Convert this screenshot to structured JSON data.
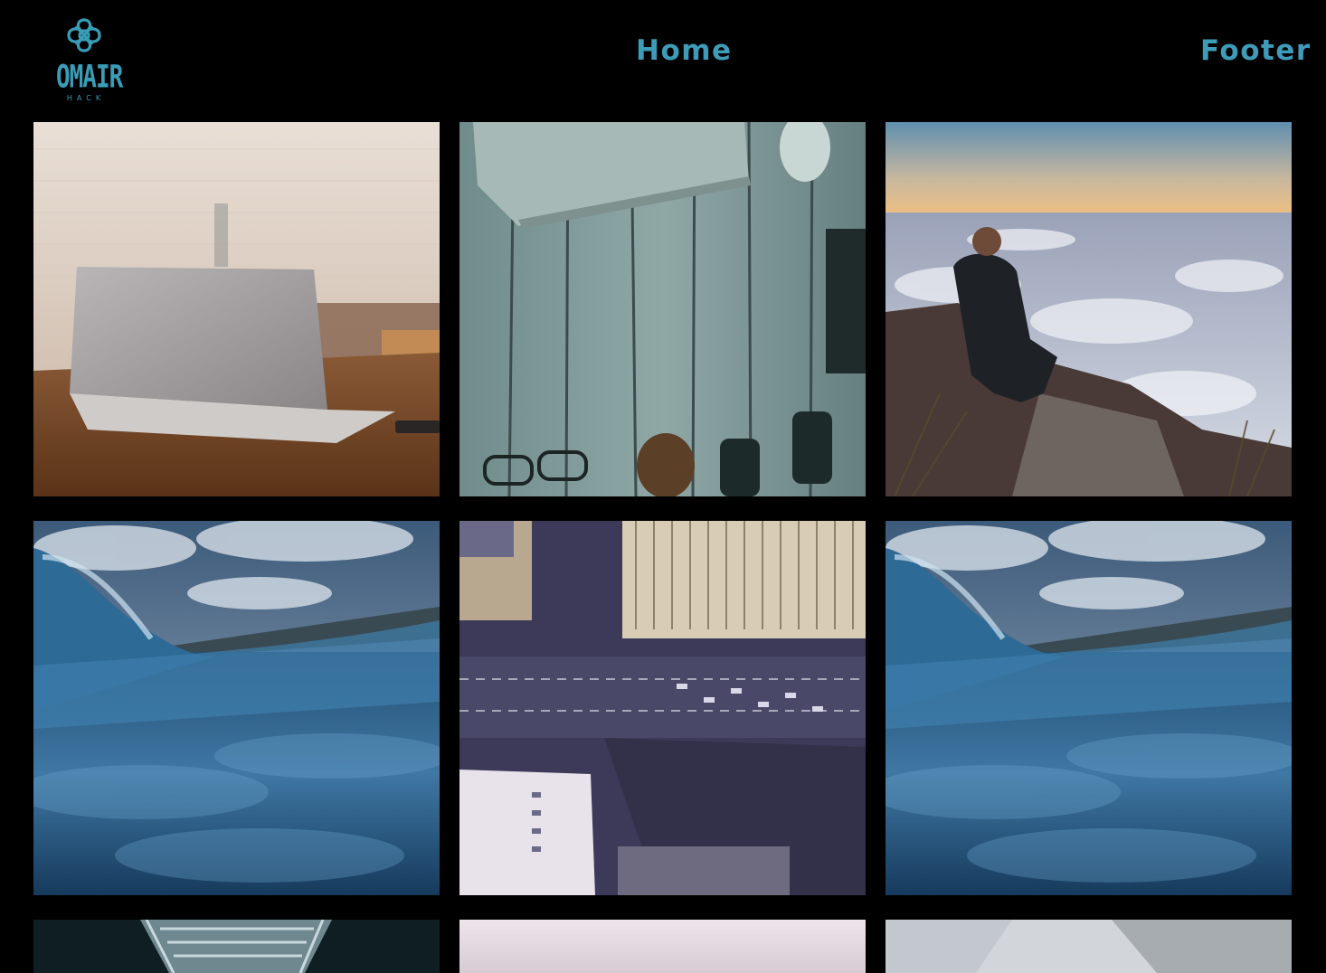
{
  "header": {
    "logo": {
      "icon": "celtic-knot-icon",
      "wordmark": "OMAIR",
      "subtitle": "HACK"
    },
    "nav": [
      {
        "label": "Home"
      },
      {
        "label": "Footer"
      }
    ]
  },
  "gallery": {
    "images": [
      {
        "subject": "laptop-on-wooden-table"
      },
      {
        "subject": "laptop-and-items-on-wood-planks"
      },
      {
        "subject": "man-sitting-above-clouds"
      },
      {
        "subject": "ocean-wave"
      },
      {
        "subject": "aerial-city-streets"
      },
      {
        "subject": "ocean-wave"
      },
      {
        "subject": "hallway-skylight"
      },
      {
        "subject": "pale-sky"
      },
      {
        "subject": "grey-blurred-scene"
      }
    ]
  },
  "colors": {
    "background": "#000000",
    "accent": "#3e9cb8"
  }
}
